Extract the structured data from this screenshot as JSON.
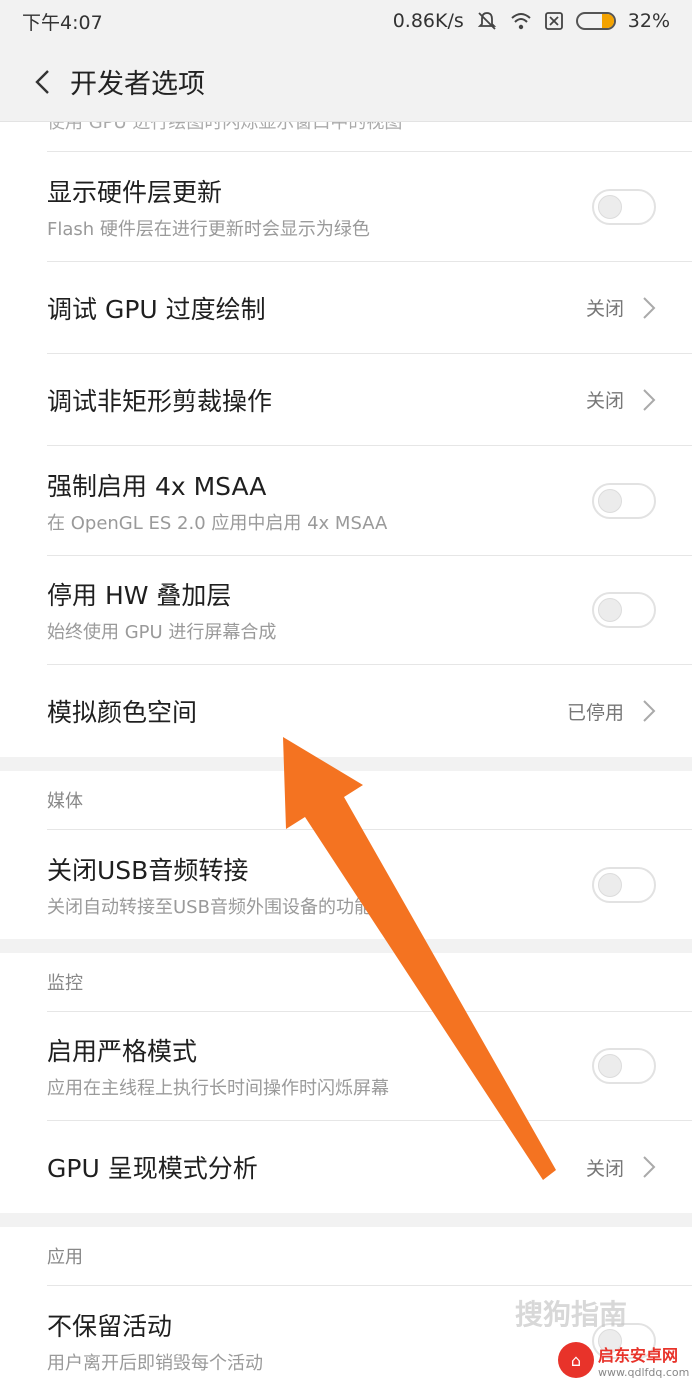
{
  "status_bar": {
    "time": "下午4:07",
    "speed": "0.86K/s",
    "battery": "32%",
    "battery_level": 0.32
  },
  "header": {
    "title": "开发者选项"
  },
  "truncated_text": "使用 GPU 进行绘图时闪烁显示窗口中的视图",
  "items_group1": [
    {
      "title": "显示硬件层更新",
      "subtitle": "Flash 硬件层在进行更新时会显示为绿色",
      "type": "toggle",
      "on": false
    },
    {
      "title": "调试 GPU 过度绘制",
      "value": "关闭",
      "type": "nav"
    },
    {
      "title": "调试非矩形剪裁操作",
      "value": "关闭",
      "type": "nav"
    },
    {
      "title": "强制启用 4x MSAA",
      "subtitle": "在 OpenGL ES 2.0 应用中启用 4x MSAA",
      "type": "toggle",
      "on": false
    },
    {
      "title": "停用 HW 叠加层",
      "subtitle": "始终使用 GPU 进行屏幕合成",
      "type": "toggle",
      "on": false
    },
    {
      "title": "模拟颜色空间",
      "value": "已停用",
      "type": "nav"
    }
  ],
  "section_media": {
    "header": "媒体",
    "items": [
      {
        "title": "关闭USB音频转接",
        "subtitle": "关闭自动转接至USB音频外围设备的功能",
        "type": "toggle",
        "on": false
      }
    ]
  },
  "section_monitor": {
    "header": "监控",
    "items": [
      {
        "title": "启用严格模式",
        "subtitle": "应用在主线程上执行长时间操作时闪烁屏幕",
        "type": "toggle",
        "on": false
      },
      {
        "title": "GPU 呈现模式分析",
        "value": "关闭",
        "type": "nav"
      }
    ]
  },
  "section_apps": {
    "header": "应用",
    "items": [
      {
        "title": "不保留活动",
        "subtitle": "用户离开后即销毁每个活动",
        "type": "toggle",
        "on": false
      }
    ]
  },
  "watermarks": {
    "sogou": "搜狗指南",
    "site_name": "启东安卓网",
    "site_url": "www.qdlfdq.com"
  },
  "annotation_color": "#f47321"
}
